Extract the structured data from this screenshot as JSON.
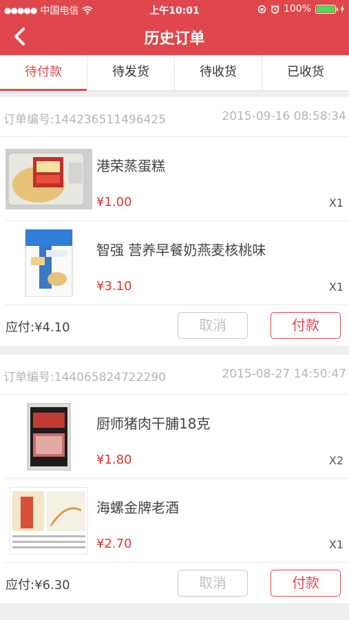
{
  "status_bar": {
    "signal": "●●●●●",
    "carrier": "中国电信",
    "wifi_icon": "wifi-icon",
    "time": "上午10:01",
    "battery": "100%",
    "battery_level": 1.0,
    "battery_color": "#3ce25c"
  },
  "header": {
    "back_icon": "chevron-left-icon",
    "title": "历史订单",
    "bar_color": "#e0474c"
  },
  "tabs": [
    {
      "label": "待付款",
      "active": true
    },
    {
      "label": "待发货",
      "active": false
    },
    {
      "label": "待收货",
      "active": false
    },
    {
      "label": "已收货",
      "active": false
    }
  ],
  "orders": [
    {
      "order_no": "订单编号:144236511496425",
      "time": "2015-09-16 08:58:34",
      "items": [
        {
          "name": "港荣蒸蛋糕",
          "price": "¥1.00",
          "qty": "X1"
        },
        {
          "name": "智强 营养早餐奶燕麦核桃味",
          "price": "¥3.10",
          "qty": "X1"
        }
      ],
      "due": "应付:¥4.10",
      "cancel_label": "取消",
      "pay_label": "付款"
    },
    {
      "order_no": "订单编号:144065824722290",
      "time": "2015-08-27 14:50:47",
      "items": [
        {
          "name": "厨师猪肉干脯18克",
          "price": "¥1.80",
          "qty": "X2"
        },
        {
          "name": "海螺金牌老酒",
          "price": "¥2.70",
          "qty": "X1"
        }
      ],
      "due": "应付:¥6.30",
      "cancel_label": "取消",
      "pay_label": "付款"
    }
  ],
  "colors": {
    "accent": "#e0474c",
    "price": "#e0332d"
  }
}
